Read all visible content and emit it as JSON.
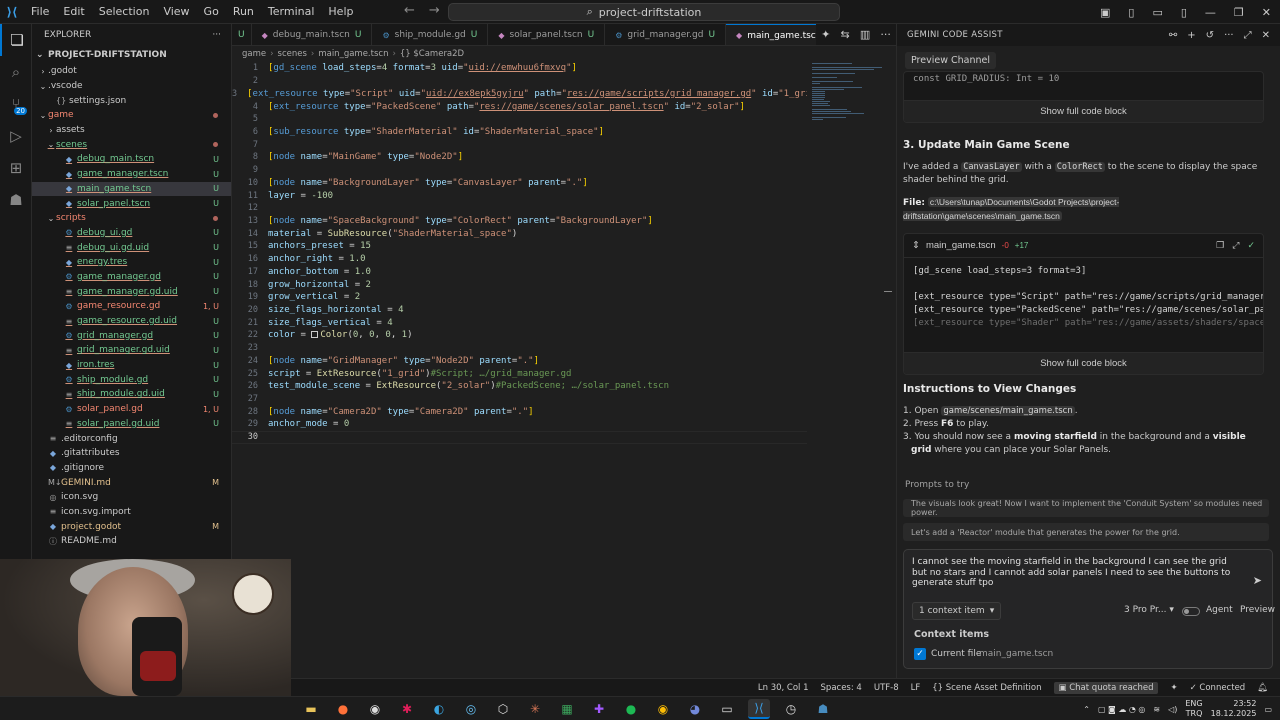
{
  "titlebar": {
    "menu": [
      "File",
      "Edit",
      "Selection",
      "View",
      "Go",
      "Run",
      "Terminal",
      "Help"
    ],
    "search": "project-driftstation"
  },
  "explorer": {
    "title": "EXPLORER",
    "root": "PROJECT-DRIFTSTATION",
    "rows": [
      {
        "indent": 1,
        "chev": "›",
        "name": ".godot",
        "icon": "",
        "cls": "",
        "status": ""
      },
      {
        "indent": 1,
        "chev": "⌄",
        "name": ".vscode",
        "icon": "",
        "cls": "",
        "status": ""
      },
      {
        "indent": 2,
        "chev": "",
        "name": "settings.json",
        "icon": "{}",
        "cls": "",
        "status": ""
      },
      {
        "indent": 1,
        "chev": "⌄",
        "name": "game",
        "icon": "",
        "cls": "e",
        "status": "dot"
      },
      {
        "indent": 2,
        "chev": "›",
        "name": "assets",
        "icon": "",
        "cls": "",
        "status": ""
      },
      {
        "indent": 2,
        "chev": "⌄",
        "name": "scenes",
        "icon": "",
        "cls": "u",
        "status": "dot"
      },
      {
        "indent": 3,
        "chev": "",
        "name": "debug_main.tscn",
        "icon": "◆",
        "cls": "u",
        "status": "U"
      },
      {
        "indent": 3,
        "chev": "",
        "name": "game_manager.tscn",
        "icon": "◆",
        "cls": "u",
        "status": "U"
      },
      {
        "indent": 3,
        "chev": "",
        "name": "main_game.tscn",
        "icon": "◆",
        "cls": "u sel",
        "status": "U"
      },
      {
        "indent": 3,
        "chev": "",
        "name": "solar_panel.tscn",
        "icon": "◆",
        "cls": "u",
        "status": "U"
      },
      {
        "indent": 2,
        "chev": "⌄",
        "name": "scripts",
        "icon": "",
        "cls": "e",
        "status": "dot"
      },
      {
        "indent": 3,
        "chev": "",
        "name": "debug_ui.gd",
        "icon": "⚙",
        "cls": "u",
        "status": "U"
      },
      {
        "indent": 3,
        "chev": "",
        "name": "debug_ui.gd.uid",
        "icon": "≡",
        "cls": "u",
        "status": "U"
      },
      {
        "indent": 3,
        "chev": "",
        "name": "energy.tres",
        "icon": "◆",
        "cls": "u",
        "status": "U"
      },
      {
        "indent": 3,
        "chev": "",
        "name": "game_manager.gd",
        "icon": "⚙",
        "cls": "u",
        "status": "U"
      },
      {
        "indent": 3,
        "chev": "",
        "name": "game_manager.gd.uid",
        "icon": "≡",
        "cls": "u",
        "status": "U"
      },
      {
        "indent": 3,
        "chev": "",
        "name": "game_resource.gd",
        "icon": "⚙",
        "cls": "e",
        "status": "1, U"
      },
      {
        "indent": 3,
        "chev": "",
        "name": "game_resource.gd.uid",
        "icon": "≡",
        "cls": "u",
        "status": "U"
      },
      {
        "indent": 3,
        "chev": "",
        "name": "grid_manager.gd",
        "icon": "⚙",
        "cls": "u",
        "status": "U"
      },
      {
        "indent": 3,
        "chev": "",
        "name": "grid_manager.gd.uid",
        "icon": "≡",
        "cls": "u",
        "status": "U"
      },
      {
        "indent": 3,
        "chev": "",
        "name": "iron.tres",
        "icon": "◆",
        "cls": "u",
        "status": "U"
      },
      {
        "indent": 3,
        "chev": "",
        "name": "ship_module.gd",
        "icon": "⚙",
        "cls": "u",
        "status": "U"
      },
      {
        "indent": 3,
        "chev": "",
        "name": "ship_module.gd.uid",
        "icon": "≡",
        "cls": "u",
        "status": "U"
      },
      {
        "indent": 3,
        "chev": "",
        "name": "solar_panel.gd",
        "icon": "⚙",
        "cls": "e",
        "status": "1, U"
      },
      {
        "indent": 3,
        "chev": "",
        "name": "solar_panel.gd.uid",
        "icon": "≡",
        "cls": "u",
        "status": "U"
      },
      {
        "indent": 1,
        "chev": "",
        "name": ".editorconfig",
        "icon": "≡",
        "cls": "",
        "status": ""
      },
      {
        "indent": 1,
        "chev": "",
        "name": ".gitattributes",
        "icon": "◆",
        "cls": "",
        "status": ""
      },
      {
        "indent": 1,
        "chev": "",
        "name": ".gitignore",
        "icon": "◆",
        "cls": "",
        "status": ""
      },
      {
        "indent": 1,
        "chev": "",
        "name": "GEMINI.md",
        "icon": "M↓",
        "cls": "m",
        "status": "M"
      },
      {
        "indent": 1,
        "chev": "",
        "name": "icon.svg",
        "icon": "◎",
        "cls": "",
        "status": ""
      },
      {
        "indent": 1,
        "chev": "",
        "name": "icon.svg.import",
        "icon": "≡",
        "cls": "",
        "status": ""
      },
      {
        "indent": 1,
        "chev": "",
        "name": "project.godot",
        "icon": "◆",
        "cls": "m",
        "status": "M"
      },
      {
        "indent": 1,
        "chev": "",
        "name": "README.md",
        "icon": "ⓘ",
        "cls": "",
        "status": ""
      }
    ]
  },
  "tabs": [
    {
      "name": "debug_main.tscn",
      "status": "U",
      "active": false
    },
    {
      "name": "ship_module.gd",
      "status": "U",
      "active": false
    },
    {
      "name": "solar_panel.tscn",
      "status": "U",
      "active": false
    },
    {
      "name": "grid_manager.gd",
      "status": "U",
      "active": false
    },
    {
      "name": "main_game.tscn",
      "status": "U",
      "active": true
    }
  ],
  "breadcrumb": [
    "game",
    "scenes",
    "main_game.tscn",
    "{} $Camera2D"
  ],
  "code": [
    [
      [
        "b",
        "["
      ],
      [
        "k",
        "gd_scene "
      ],
      [
        "a",
        "load_steps"
      ],
      [
        "p",
        "="
      ],
      [
        "n",
        "4 "
      ],
      [
        "a",
        "format"
      ],
      [
        "p",
        "="
      ],
      [
        "n",
        "3 "
      ],
      [
        "a",
        "uid"
      ],
      [
        "p",
        "="
      ],
      [
        "s",
        "\""
      ],
      [
        "u",
        "uid://emwhuu6fmxvq"
      ],
      [
        "s",
        "\""
      ],
      [
        "b",
        "]"
      ]
    ],
    [],
    [
      [
        "b",
        "["
      ],
      [
        "k",
        "ext_resource "
      ],
      [
        "a",
        "type"
      ],
      [
        "p",
        "="
      ],
      [
        "s",
        "\"Script\" "
      ],
      [
        "a",
        "uid"
      ],
      [
        "p",
        "="
      ],
      [
        "s",
        "\""
      ],
      [
        "u",
        "uid://ex8epk5gyjru"
      ],
      [
        "s",
        "\" "
      ],
      [
        "a",
        "path"
      ],
      [
        "p",
        "="
      ],
      [
        "s",
        "\""
      ],
      [
        "u",
        "res://game/scripts/grid_manager.gd"
      ],
      [
        "s",
        "\" "
      ],
      [
        "a",
        "id"
      ],
      [
        "p",
        "="
      ],
      [
        "s",
        "\"1_grid\""
      ],
      [
        "b",
        "]"
      ]
    ],
    [
      [
        "b",
        "["
      ],
      [
        "k",
        "ext_resource "
      ],
      [
        "a",
        "type"
      ],
      [
        "p",
        "="
      ],
      [
        "s",
        "\"PackedScene\" "
      ],
      [
        "a",
        "path"
      ],
      [
        "p",
        "="
      ],
      [
        "s",
        "\""
      ],
      [
        "u",
        "res://game/scenes/solar_panel.tscn"
      ],
      [
        "s",
        "\" "
      ],
      [
        "a",
        "id"
      ],
      [
        "p",
        "="
      ],
      [
        "s",
        "\"2_solar\""
      ],
      [
        "b",
        "]"
      ]
    ],
    [],
    [
      [
        "b",
        "["
      ],
      [
        "k",
        "sub_resource "
      ],
      [
        "a",
        "type"
      ],
      [
        "p",
        "="
      ],
      [
        "s",
        "\"ShaderMaterial\" "
      ],
      [
        "a",
        "id"
      ],
      [
        "p",
        "="
      ],
      [
        "s",
        "\"ShaderMaterial_space\""
      ],
      [
        "b",
        "]"
      ]
    ],
    [],
    [
      [
        "b",
        "["
      ],
      [
        "k",
        "node "
      ],
      [
        "a",
        "name"
      ],
      [
        "p",
        "="
      ],
      [
        "s",
        "\"MainGame\" "
      ],
      [
        "a",
        "type"
      ],
      [
        "p",
        "="
      ],
      [
        "s",
        "\"Node2D\""
      ],
      [
        "b",
        "]"
      ]
    ],
    [],
    [
      [
        "b",
        "["
      ],
      [
        "k",
        "node "
      ],
      [
        "a",
        "name"
      ],
      [
        "p",
        "="
      ],
      [
        "s",
        "\"BackgroundLayer\" "
      ],
      [
        "a",
        "type"
      ],
      [
        "p",
        "="
      ],
      [
        "s",
        "\"CanvasLayer\" "
      ],
      [
        "a",
        "parent"
      ],
      [
        "p",
        "="
      ],
      [
        "s",
        "\".\""
      ],
      [
        "b",
        "]"
      ]
    ],
    [
      [
        "a",
        "layer"
      ],
      [
        "p",
        " = "
      ],
      [
        "n",
        "-100"
      ]
    ],
    [],
    [
      [
        "b",
        "["
      ],
      [
        "k",
        "node "
      ],
      [
        "a",
        "name"
      ],
      [
        "p",
        "="
      ],
      [
        "s",
        "\"SpaceBackground\" "
      ],
      [
        "a",
        "type"
      ],
      [
        "p",
        "="
      ],
      [
        "s",
        "\"ColorRect\" "
      ],
      [
        "a",
        "parent"
      ],
      [
        "p",
        "="
      ],
      [
        "s",
        "\"BackgroundLayer\""
      ],
      [
        "b",
        "]"
      ]
    ],
    [
      [
        "a",
        "material"
      ],
      [
        "p",
        " = "
      ],
      [
        "f",
        "SubResource"
      ],
      [
        "p",
        "("
      ],
      [
        "s",
        "\"ShaderMaterial_space\""
      ],
      [
        "p",
        ")"
      ]
    ],
    [
      [
        "a",
        "anchors_preset"
      ],
      [
        "p",
        " = "
      ],
      [
        "n",
        "15"
      ]
    ],
    [
      [
        "a",
        "anchor_right"
      ],
      [
        "p",
        " = "
      ],
      [
        "n",
        "1.0"
      ]
    ],
    [
      [
        "a",
        "anchor_bottom"
      ],
      [
        "p",
        " = "
      ],
      [
        "n",
        "1.0"
      ]
    ],
    [
      [
        "a",
        "grow_horizontal"
      ],
      [
        "p",
        " = "
      ],
      [
        "n",
        "2"
      ]
    ],
    [
      [
        "a",
        "grow_vertical"
      ],
      [
        "p",
        " = "
      ],
      [
        "n",
        "2"
      ]
    ],
    [
      [
        "a",
        "size_flags_horizontal"
      ],
      [
        "p",
        " = "
      ],
      [
        "n",
        "4"
      ]
    ],
    [
      [
        "a",
        "size_flags_vertical"
      ],
      [
        "p",
        " = "
      ],
      [
        "n",
        "4"
      ]
    ],
    [
      [
        "a",
        "color"
      ],
      [
        "p",
        " = "
      ],
      [
        "sw",
        ""
      ],
      [
        "f",
        "Color"
      ],
      [
        "p",
        "("
      ],
      [
        "n",
        "0"
      ],
      [
        "p",
        ", "
      ],
      [
        "n",
        "0"
      ],
      [
        "p",
        ", "
      ],
      [
        "n",
        "0"
      ],
      [
        "p",
        ", "
      ],
      [
        "n",
        "1"
      ],
      [
        "p",
        ")"
      ]
    ],
    [],
    [
      [
        "b",
        "["
      ],
      [
        "k",
        "node "
      ],
      [
        "a",
        "name"
      ],
      [
        "p",
        "="
      ],
      [
        "s",
        "\"GridManager\" "
      ],
      [
        "a",
        "type"
      ],
      [
        "p",
        "="
      ],
      [
        "s",
        "\"Node2D\" "
      ],
      [
        "a",
        "parent"
      ],
      [
        "p",
        "="
      ],
      [
        "s",
        "\".\""
      ],
      [
        "b",
        "]"
      ]
    ],
    [
      [
        "a",
        "script"
      ],
      [
        "p",
        " = "
      ],
      [
        "f",
        "ExtResource"
      ],
      [
        "p",
        "("
      ],
      [
        "s",
        "\"1_grid\""
      ],
      [
        "p",
        ")"
      ],
      [
        "c",
        "#Script; …/grid_manager.gd"
      ]
    ],
    [
      [
        "a",
        "test_module_scene"
      ],
      [
        "p",
        " = "
      ],
      [
        "f",
        "ExtResource"
      ],
      [
        "p",
        "("
      ],
      [
        "s",
        "\"2_solar\""
      ],
      [
        "p",
        ")"
      ],
      [
        "c",
        "#PackedScene; …/solar_panel.tscn"
      ]
    ],
    [],
    [
      [
        "b",
        "["
      ],
      [
        "k",
        "node "
      ],
      [
        "a",
        "name"
      ],
      [
        "p",
        "="
      ],
      [
        "s",
        "\"Camera2D\" "
      ],
      [
        "a",
        "type"
      ],
      [
        "p",
        "="
      ],
      [
        "s",
        "\"Camera2D\" "
      ],
      [
        "a",
        "parent"
      ],
      [
        "p",
        "="
      ],
      [
        "s",
        "\".\""
      ],
      [
        "b",
        "]"
      ]
    ],
    [
      [
        "a",
        "anchor_mode"
      ],
      [
        "p",
        " = "
      ],
      [
        "n",
        "0"
      ]
    ],
    []
  ],
  "panel": {
    "title": "GEMINI CODE ASSIST",
    "preview_channel": "Preview Channel",
    "code1_line": "const GRID_RADIUS: Int = 10",
    "show_full": "Show full code block",
    "h_update": "3. Update Main Game Scene",
    "update_text_1": "I've added a ",
    "canvas_layer": "CanvasLayer",
    "update_text_2": " with a ",
    "color_rect": "ColorRect",
    "update_text_3": " to the scene to display the space shader behind the grid.",
    "file_label": "File:",
    "file_path": "c:\\Users\\tunap\\Documents\\Godot Projects\\project-driftstation\\game\\scenes\\main_game.tscn",
    "file_name": "main_game.tscn",
    "minus": "-0",
    "plus": "+17",
    "code2": [
      "[gd_scene load_steps=3 format=3]",
      "",
      "[ext_resource type=\"Script\" path=\"res://game/scripts/grid_manager.gd\" id=\"1_grid\"]",
      "[ext_resource type=\"PackedScene\" path=\"res://game/scenes/solar_panel.tscn\" id=\"2_solar\"]",
      "[ext_resource type=\"Shader\" path=\"res://game/assets/shaders/space_background.gdshader\" id=\"3_shader\"]"
    ],
    "h_instr": "Instructions to View Changes",
    "instr_1a": "Open ",
    "instr_1b": "game/scenes/main_game.tscn",
    "instr_2a": "Press ",
    "instr_2b": "F6",
    "instr_2c": " to play.",
    "instr_3a": "You should now see a ",
    "instr_3b": "moving starfield",
    "instr_3c": " in the background and a ",
    "instr_3d": "visible grid",
    "instr_3e": " where you can place your Solar Panels.",
    "prompts_label": "Prompts to try",
    "prompt_1": "The visuals look great! Now I want to implement the 'Conduit System' so modules need power.",
    "prompt_2": "Let's add a 'Reactor' module that generates the power for the grid.",
    "input_text": "I cannot see the moving starfield in the background I can see the grid but no stars and I cannot add solar panels I need to see the buttons to generate stuff tpo",
    "context_items_btn": "1 context item",
    "model": "3 Pro Pr...",
    "agent": "Agent",
    "preview": "Preview",
    "context_items": "Context items",
    "current_file": "Current file",
    "current_file_value": "main_game.tscn"
  },
  "statusbar": {
    "position": "Ln 30, Col 1",
    "spaces": "Spaces: 4",
    "encoding": "UTF-8",
    "eol": "LF",
    "language": "Scene Asset Definition",
    "quota": "Chat quota reached",
    "connected": "Connected"
  },
  "taskbar": {
    "lang1": "ENG",
    "lang2": "TRQ",
    "time": "23:52",
    "date": "18.12.2025"
  },
  "colors": {
    "accent": "#0078d4",
    "untracked": "#73c991",
    "modified": "#e2c08d",
    "error": "#f48771"
  }
}
